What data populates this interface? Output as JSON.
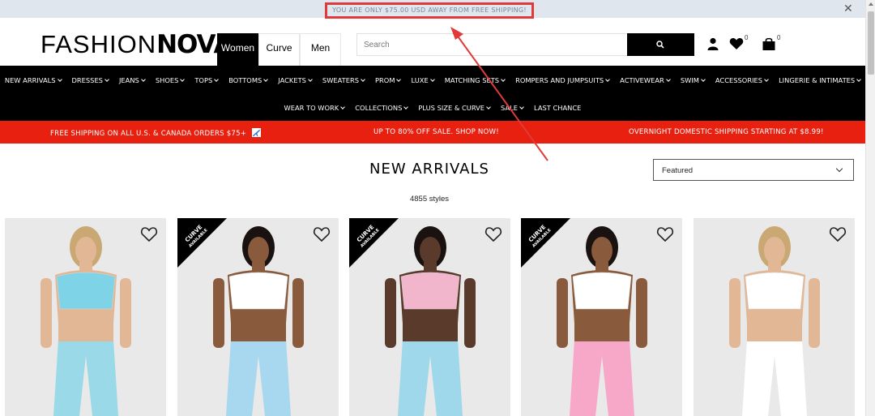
{
  "topbar": {
    "message": "YOU ARE ONLY $75.00 USD AWAY FROM FREE SHIPPING!",
    "close_icon": "close-icon"
  },
  "brand": {
    "logo_thin": "FASHION",
    "logo_bold": "NOVA"
  },
  "gender_tabs": [
    {
      "label": "Women",
      "active": true
    },
    {
      "label": "Curve",
      "active": false
    },
    {
      "label": "Men",
      "active": false
    }
  ],
  "search": {
    "placeholder": "Search",
    "icon": "search-icon"
  },
  "account": {
    "account_icon": "user-icon",
    "wishlist_icon": "heart-icon",
    "wishlist_count": "0",
    "cart_icon": "shopping-bag-icon",
    "cart_count": "0"
  },
  "nav": {
    "row1": [
      {
        "label": "NEW ARRIVALS",
        "caret": true
      },
      {
        "label": "DRESSES",
        "caret": true
      },
      {
        "label": "JEANS",
        "caret": true
      },
      {
        "label": "SHOES",
        "caret": true
      },
      {
        "label": "TOPS",
        "caret": true
      },
      {
        "label": "BOTTOMS",
        "caret": true
      },
      {
        "label": "JACKETS",
        "caret": true
      },
      {
        "label": "SWEATERS",
        "caret": true
      },
      {
        "label": "PROM",
        "caret": true
      },
      {
        "label": "LUXE",
        "caret": true
      },
      {
        "label": "MATCHING SETS",
        "caret": true
      },
      {
        "label": "ROMPERS AND JUMPSUITS",
        "caret": true
      },
      {
        "label": "ACTIVEWEAR",
        "caret": true
      },
      {
        "label": "SWIM",
        "caret": true
      },
      {
        "label": "ACCESSORIES",
        "caret": true
      },
      {
        "label": "LINGERIE & INTIMATES",
        "caret": true
      }
    ],
    "row2": [
      {
        "label": "WEAR TO WORK",
        "caret": true
      },
      {
        "label": "COLLECTIONS",
        "caret": true
      },
      {
        "label": "PLUS SIZE & CURVE",
        "caret": true
      },
      {
        "label": "SALE",
        "caret": true
      },
      {
        "label": "LAST CHANCE",
        "caret": false
      }
    ]
  },
  "promo": {
    "left": "FREE SHIPPING ON ALL U.S. & CANADA ORDERS $75+",
    "left_icon": "airplane-icon",
    "center": "UP TO 80% OFF SALE. SHOP NOW!",
    "right": "OVERNIGHT DOMESTIC SHIPPING STARTING AT $8.99!"
  },
  "listing": {
    "title": "NEW ARRIVALS",
    "count": "4855 styles",
    "sort_selected": "Featured"
  },
  "products": [
    {
      "curve": false,
      "top_color": "#7fd3e6",
      "bottom_color": "#9ad9e8"
    },
    {
      "curve": true,
      "top_color": "#ffffff",
      "bottom_color": "#a8d8f0"
    },
    {
      "curve": true,
      "top_color": "#f2b6cc",
      "bottom_color": "#9ed8ea"
    },
    {
      "curve": true,
      "top_color": "#ffffff",
      "bottom_color": "#f7a8c8"
    },
    {
      "curve": false,
      "top_color": "#ffffff",
      "bottom_color": "#ffffff"
    }
  ],
  "curve_ribbon": {
    "line1": "CURVE",
    "line2": "AVAILABLE"
  },
  "colors": {
    "promo_bg": "#e8200f",
    "nav_bg": "#000000",
    "topbar_bg": "#dfe6ee",
    "annotation": "#e03a3a"
  }
}
